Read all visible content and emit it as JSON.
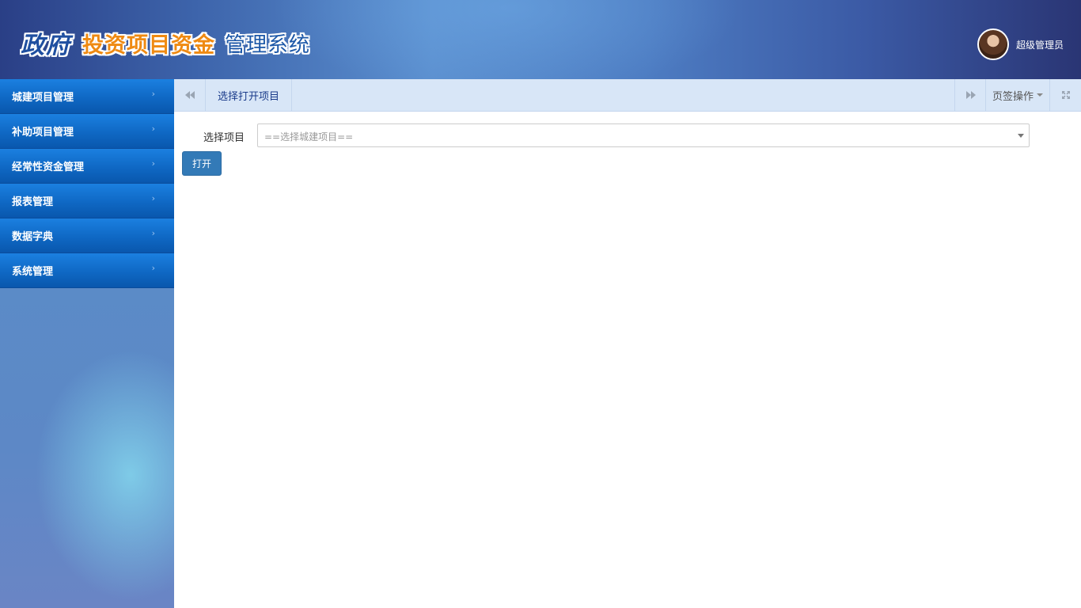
{
  "header": {
    "logo_script": "政府",
    "logo_main": "投资项目资金",
    "logo_sub": "管理系统",
    "user_name": "超级管理员",
    "avatar_icon": "user-avatar"
  },
  "sidebar": {
    "items": [
      {
        "label": "城建项目管理",
        "arrow": "›"
      },
      {
        "label": "补助项目管理",
        "arrow": "›"
      },
      {
        "label": "经常性资金管理",
        "arrow": "›"
      },
      {
        "label": "报表管理",
        "arrow": "›"
      },
      {
        "label": "数据字典",
        "arrow": "›"
      },
      {
        "label": "系统管理",
        "arrow": "›"
      }
    ]
  },
  "tabbar": {
    "prev_icon": "backward-icon",
    "active_tab": "选择打开项目",
    "next_icon": "forward-icon",
    "ops_label": "页签操作",
    "fullscreen_icon": "expand-icon"
  },
  "form": {
    "label": "选择项目",
    "select_value": "==选择城建项目==",
    "open_button": "打开"
  },
  "colors": {
    "accent": "#337ab7",
    "menu_blue": "#0f68c4",
    "tabbar_bg": "#d8e6f7",
    "logo_orange": "#ef8a12"
  }
}
